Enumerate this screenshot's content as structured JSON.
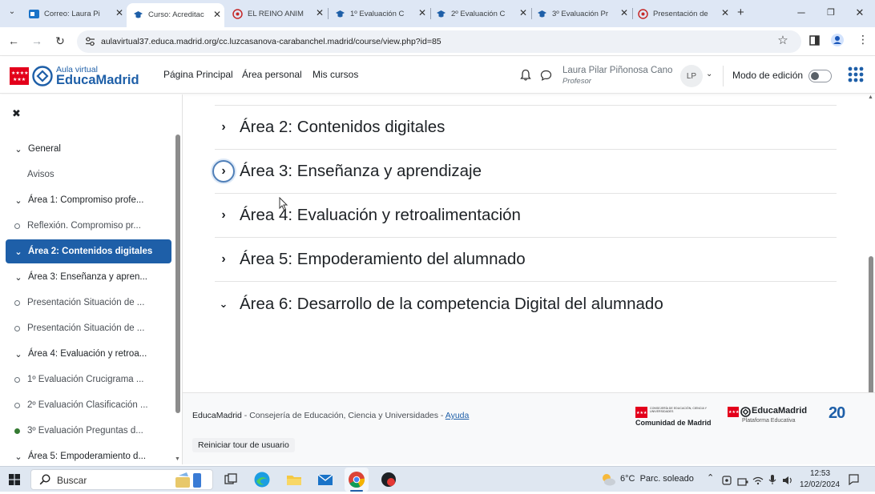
{
  "browser": {
    "tabs": [
      {
        "title": "Correo: Laura Pi"
      },
      {
        "title": "Curso: Acreditac"
      },
      {
        "title": "EL REINO ANIM"
      },
      {
        "title": "1º Evaluación C"
      },
      {
        "title": "2º Evaluación C"
      },
      {
        "title": "3º Evaluación Pr"
      },
      {
        "title": "Presentación de"
      }
    ],
    "url": "aulavirtual37.educa.madrid.org/cc.luzcasanova-carabanchel.madrid/course/view.php?id=85"
  },
  "header": {
    "logo_line1": "Aula virtual",
    "logo_line2": "EducaMadrid",
    "nav": [
      "Página Principal",
      "Área personal",
      "Mis cursos"
    ],
    "user_name": "Laura Pilar Piñonosa Cano",
    "user_role": "Profesor",
    "avatar_initials": "LP",
    "edit_mode_label": "Modo de edición",
    "edit_mode_on": false
  },
  "sidebar": {
    "close_symbol": "✖",
    "items": [
      {
        "label": "General",
        "kind": "section"
      },
      {
        "label": "Avisos",
        "kind": "plain"
      },
      {
        "label": "Área 1: Compromiso profe...",
        "kind": "section"
      },
      {
        "label": "Reflexión. Compromiso pr...",
        "kind": "activity"
      },
      {
        "label": "Área 2: Contenidos digitales",
        "kind": "section",
        "active": true
      },
      {
        "label": "Área 3: Enseñanza y apren...",
        "kind": "section"
      },
      {
        "label": "Presentación Situación de ...",
        "kind": "activity"
      },
      {
        "label": "Presentación Situación de ...",
        "kind": "activity"
      },
      {
        "label": "Área 4: Evaluación y retroa...",
        "kind": "section"
      },
      {
        "label": "1º Evaluación Crucigrama ...",
        "kind": "activity"
      },
      {
        "label": "2º Evaluación Clasificación ...",
        "kind": "activity"
      },
      {
        "label": "3º Evaluación Preguntas d...",
        "kind": "activity-done"
      },
      {
        "label": "Área 5: Empoderamiento d...",
        "kind": "section"
      }
    ]
  },
  "main": {
    "sections": [
      {
        "title": "Área 2: Contenidos digitales",
        "expanded": false
      },
      {
        "title": "Área 3: Enseñanza y aprendizaje",
        "expanded": false,
        "focused": true
      },
      {
        "title": "Área 4: Evaluación y retroalimentación",
        "expanded": false
      },
      {
        "title": "Área 5: Empoderamiento del alumnado",
        "expanded": false
      },
      {
        "title": "Área 6: Desarrollo de la competencia Digital del alumnado",
        "expanded": true
      }
    ]
  },
  "footer": {
    "brand": "EducaMadrid",
    "text": " - Consejería de Educación, Ciencia y Universidades - ",
    "help_link": "Ayuda",
    "tour_link": "Reiniciar tour de usuario",
    "logo_cm_small": "CONSEJERÍA DE EDUCACIÓN, CIENCIA Y UNIVERSIDADES",
    "logo_cm": "Comunidad de Madrid",
    "logo_em": "EducaMadrid",
    "logo_em_sub": "Plataforma Educativa",
    "logo_20": "20"
  },
  "taskbar": {
    "search_placeholder": "Buscar",
    "weather": "6°C  Parc. soleado",
    "time": "12:53",
    "date": "12/02/2024"
  },
  "colors": {
    "accent": "#1e5fa8",
    "tabstrip": "#dee7f5",
    "madrid_red": "#e3001b"
  }
}
